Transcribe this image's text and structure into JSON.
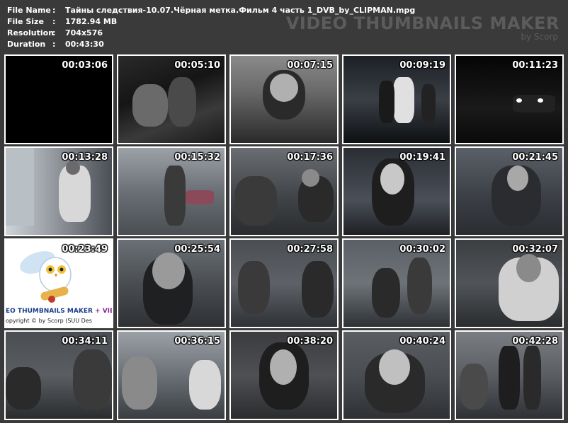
{
  "info": {
    "rows": [
      {
        "label": "File Name",
        "value": "Тайны следствия-10.07.Чёрная метка.Фильм 4 часть 1_DVB_by_CLIPMAN.mpg"
      },
      {
        "label": "File Size",
        "value": "1782.94 MB"
      },
      {
        "label": "Resolution",
        "value": "704x576"
      },
      {
        "label": "Duration",
        "value": "00:43:30"
      }
    ],
    "separator": ":"
  },
  "brand": {
    "title": "VIDEO THUMBNAILS MAKER",
    "subtitle": "by Scorp"
  },
  "thumbnails": [
    {
      "time": "00:03:06"
    },
    {
      "time": "00:05:10"
    },
    {
      "time": "00:07:15"
    },
    {
      "time": "00:09:19"
    },
    {
      "time": "00:11:23"
    },
    {
      "time": "00:13:28"
    },
    {
      "time": "00:15:32"
    },
    {
      "time": "00:17:36"
    },
    {
      "time": "00:19:41"
    },
    {
      "time": "00:21:45"
    },
    {
      "time": "00:23:49"
    },
    {
      "time": "00:25:54"
    },
    {
      "time": "00:27:58"
    },
    {
      "time": "00:30:02"
    },
    {
      "time": "00:32:07"
    },
    {
      "time": "00:34:11"
    },
    {
      "time": "00:36:15"
    },
    {
      "time": "00:38:20"
    },
    {
      "time": "00:40:24"
    },
    {
      "time": "00:42:28"
    }
  ],
  "ad_frame": {
    "line1_a": "EO THUMBNAILS MAKER",
    "line1_b": "+ VIE",
    "line2": "opyright © by Scorp (SUU Des"
  }
}
